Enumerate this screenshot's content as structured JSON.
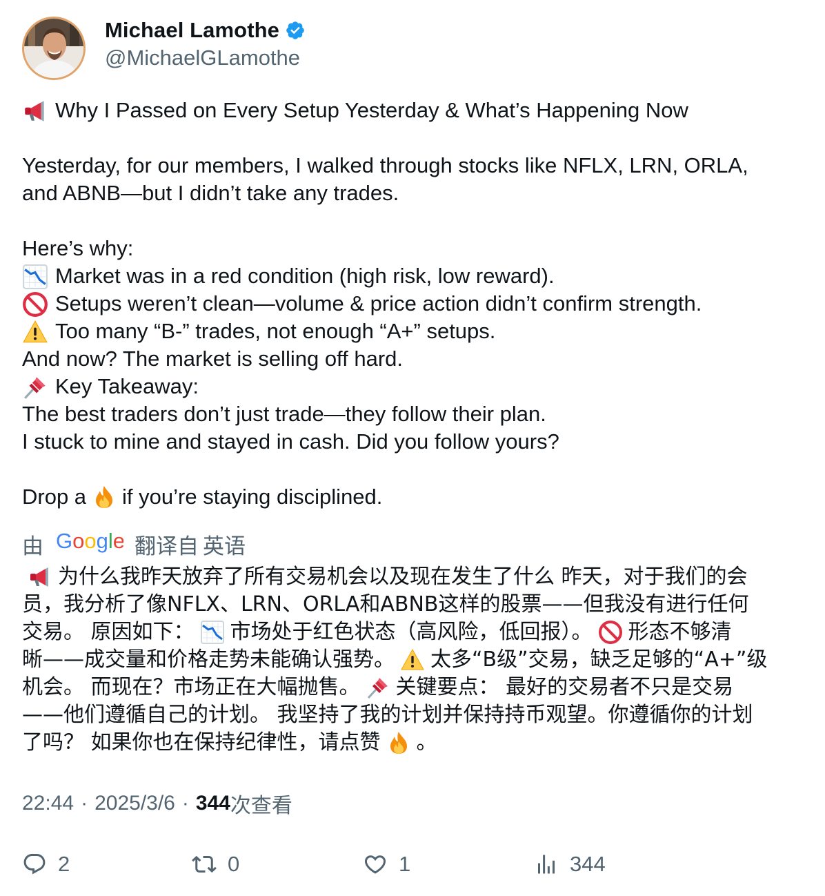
{
  "author": {
    "display_name": "Michael Lamothe",
    "handle": "@MichaelGLamothe",
    "verified": true
  },
  "post": {
    "lines": [
      {
        "emoji": "megaphone-icon",
        "text": "Why I Passed on Every Setup Yesterday & What’s Happening Now"
      },
      {
        "text": ""
      },
      {
        "text": "Yesterday, for our members, I walked through stocks like NFLX, LRN, ORLA,"
      },
      {
        "text": "and ABNB—but I didn’t take any trades."
      },
      {
        "text": ""
      },
      {
        "text": "Here’s why:"
      },
      {
        "emoji": "chart-decreasing-icon",
        "text": "Market was in a red condition (high risk, low reward)."
      },
      {
        "emoji": "prohibited-icon",
        "text": "Setups weren’t clean—volume & price action didn’t confirm strength."
      },
      {
        "emoji": "warning-icon",
        "text": "Too many “B-” trades, not enough “A+” setups."
      },
      {
        "text": "And now? The market is selling off hard."
      },
      {
        "emoji": "pushpin-icon",
        "text": "Key Takeaway:"
      },
      {
        "text": "The best traders don’t just trade—they follow their plan."
      },
      {
        "text": "I stuck to mine and stayed in cash. Did you follow yours?"
      },
      {
        "text": ""
      }
    ],
    "last_line_before": "Drop a",
    "last_line_emoji": "fire-icon",
    "last_line_after": "if you’re staying disciplined."
  },
  "translation": {
    "by_label": "由",
    "provider": "Google",
    "translated_from_label": "翻译自",
    "source_language": "英语",
    "lines": [
      {
        "segments": [
          {
            "emoji": "megaphone-icon"
          },
          {
            "text": "为什么我昨天放弃了所有交易机会以及现在发生了什么 昨天，对于我们的会"
          }
        ]
      },
      {
        "segments": [
          {
            "text": "员，我分析了像NFLX、LRN、ORLA和ABNB这样的股票——但我没有进行任何"
          }
        ]
      },
      {
        "segments": [
          {
            "text": "交易。 原因如下："
          },
          {
            "emoji": "chart-decreasing-icon"
          },
          {
            "text": "市场处于红色状态（高风险，低回报）。"
          },
          {
            "emoji": "prohibited-icon"
          },
          {
            "text": "形态不够清"
          }
        ]
      },
      {
        "segments": [
          {
            "text": "晰——成交量和价格走势未能确认强势。"
          },
          {
            "emoji": "warning-icon"
          },
          {
            "text": "太多“B级”交易，缺乏足够的“A+”级"
          }
        ]
      },
      {
        "segments": [
          {
            "text": "机会。 而现在？市场正在大幅抛售。"
          },
          {
            "emoji": "pushpin-icon"
          },
          {
            "text": "关键要点： 最好的交易者不只是交易"
          }
        ]
      },
      {
        "segments": [
          {
            "text": "——他们遵循自己的计划。 我坚持了我的计划并保持持币观望。你遵循你的计划"
          }
        ]
      },
      {
        "segments": [
          {
            "text": "了吗？ 如果你也在保持纪律性，请点赞"
          },
          {
            "emoji": "fire-icon"
          },
          {
            "text": "。"
          }
        ]
      }
    ]
  },
  "meta": {
    "time": "22:44",
    "separator": "·",
    "date": "2025/3/6",
    "views_count": "344",
    "views_label": "次查看"
  },
  "actions": {
    "replies": "2",
    "reposts": "0",
    "likes": "1",
    "views": "344"
  },
  "colors": {
    "text_primary": "#0f1419",
    "text_secondary": "#536471",
    "verified_blue": "#1d9bf0",
    "avatar_ring": "#e0a46b"
  }
}
